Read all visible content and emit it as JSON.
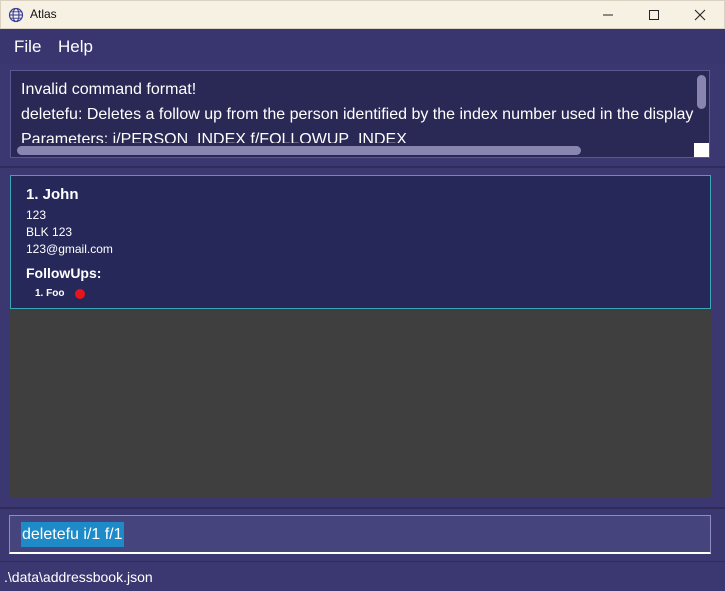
{
  "window": {
    "title": "Atlas",
    "icon": "globe-icon",
    "controls": [
      "minimize-icon",
      "maximize-icon",
      "close-icon"
    ]
  },
  "menu": {
    "items": [
      {
        "label": "File"
      },
      {
        "label": "Help"
      }
    ]
  },
  "result_display": {
    "lines": [
      "Invalid command format!",
      "deletefu: Deletes a follow up from the person identified by the index number used in the displayed person list.",
      "Parameters: i/PERSON_INDEX f/FOLLOWUP_INDEX"
    ]
  },
  "person_list": {
    "persons": [
      {
        "name": "1. John",
        "phone": "123",
        "address": "BLK 123",
        "email": "123@gmail.com",
        "followups_label": "FollowUps:",
        "followups": [
          {
            "label": "1. Foo",
            "status_color": "#e8141c"
          }
        ]
      }
    ]
  },
  "command_box": {
    "value": "deletefu i/1 f/1"
  },
  "status_bar": {
    "path": ".\\data\\addressbook.json"
  },
  "colors": {
    "background": "#3b3871",
    "card": "#27285a",
    "card_border": "#3aa6b8",
    "selection": "#1e8ac8",
    "followup_dot": "#e8141c"
  }
}
